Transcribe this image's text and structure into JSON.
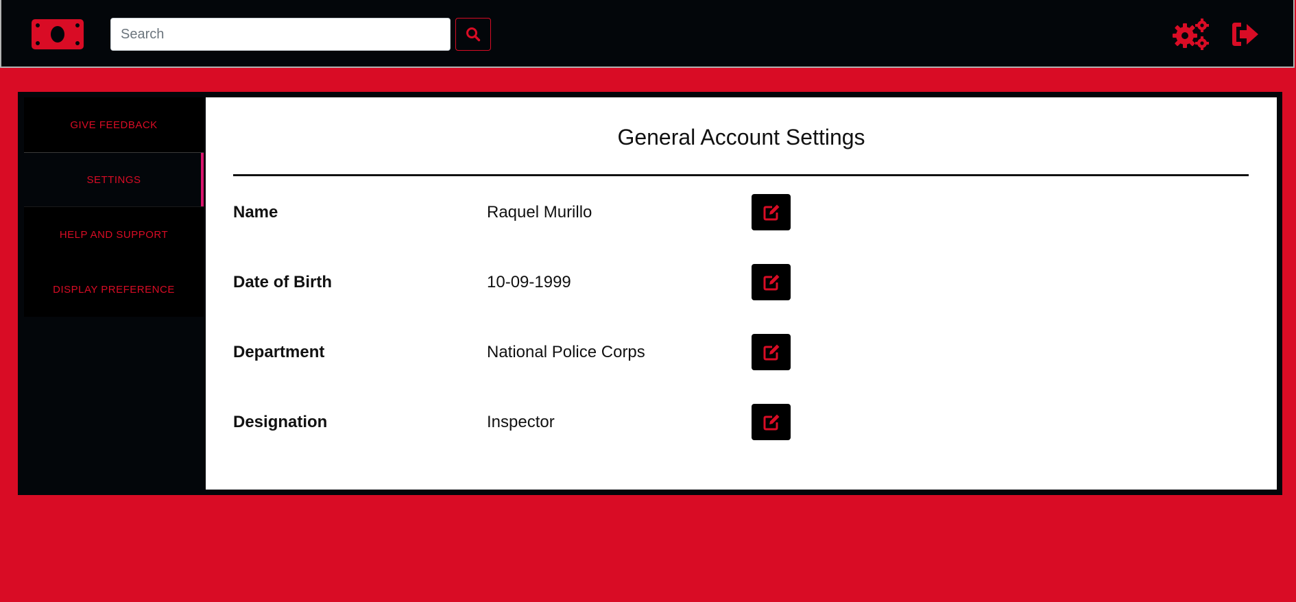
{
  "header": {
    "logo_icon": "money-bill-icon",
    "search": {
      "placeholder": "Search",
      "value": "",
      "button_icon": "search-icon"
    },
    "settings_icon": "gears-icon",
    "logout_icon": "sign-out-icon"
  },
  "sidebar": {
    "items": [
      {
        "label": "GIVE FEEDBACK",
        "active": false
      },
      {
        "label": "SETTINGS",
        "active": true
      },
      {
        "label": "HELP AND SUPPORT",
        "active": false
      },
      {
        "label": "DISPLAY PREFERENCE",
        "active": false
      }
    ]
  },
  "main": {
    "title": "General Account Settings",
    "fields": [
      {
        "label": "Name",
        "value": "Raquel Murillo",
        "edit_icon": "edit-icon"
      },
      {
        "label": "Date of Birth",
        "value": "10-09-1999",
        "edit_icon": "edit-icon"
      },
      {
        "label": "Department",
        "value": "National Police Corps",
        "edit_icon": "edit-icon"
      },
      {
        "label": "Designation",
        "value": "Inspector",
        "edit_icon": "edit-icon"
      }
    ]
  },
  "colors": {
    "accent": "#d90c25",
    "dark": "#03060a",
    "active_indicator": "#d9146c",
    "content_bg": "#ffffff"
  }
}
